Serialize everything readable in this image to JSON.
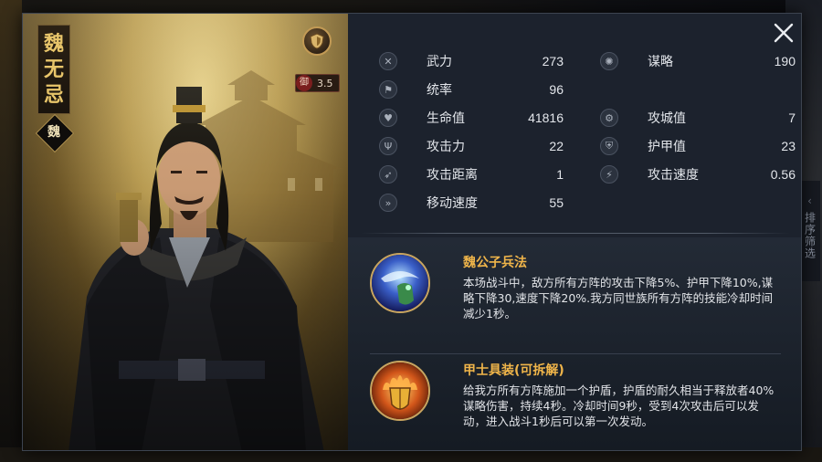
{
  "general": {
    "name_chars": [
      "魏",
      "无",
      "忌"
    ],
    "faction": "魏",
    "defense_label": "御",
    "defense_value": "3.5"
  },
  "stats_left": [
    {
      "icon": "crossed-swords-icon",
      "glyph": "✕",
      "label": "武力",
      "value": "273"
    },
    {
      "icon": "banner-icon",
      "glyph": "⚑",
      "label": "统率",
      "value": "96"
    },
    {
      "icon": "heart-icon",
      "glyph": "♥",
      "label": "生命值",
      "value": "41816"
    },
    {
      "icon": "trident-icon",
      "glyph": "Ψ",
      "label": "攻击力",
      "value": "22"
    },
    {
      "icon": "bow-icon",
      "glyph": "➶",
      "label": "攻击距离",
      "value": "1"
    },
    {
      "icon": "boot-icon",
      "glyph": "»",
      "label": "移动速度",
      "value": "55"
    }
  ],
  "stats_right": [
    {
      "icon": "brain-icon",
      "glyph": "✺",
      "label": "谋略",
      "value": "190"
    },
    {
      "icon": "catapult-icon",
      "glyph": "⚙",
      "label": "攻城值",
      "value": "7"
    },
    {
      "icon": "shield-icon",
      "glyph": "⛨",
      "label": "护甲值",
      "value": "23"
    },
    {
      "icon": "attack-speed-icon",
      "glyph": "⚡",
      "label": "攻击速度",
      "value": "0.56"
    }
  ],
  "skills": [
    {
      "icon": "water-dragon-skill-icon",
      "name": "魏公子兵法",
      "description": "本场战斗中，敌方所有方阵的攻击下降5%、护甲下降10%,谋略下降30,速度下降20%.我方同世族所有方阵的技能冷却时间减少1秒。"
    },
    {
      "icon": "fire-shield-skill-icon",
      "name": "甲士具装(可拆解)",
      "description": "给我方所有方阵施加一个护盾，护盾的耐久相当于释放者40%谋略伤害，持续4秒。冷却时间9秒，受到4次攻击后可以发动，进入战斗1秒后可以第一次发动。"
    }
  ],
  "side_tab": {
    "label": "排序筛选"
  },
  "colors": {
    "accent_gold": "#f0b54a",
    "name_gold": "#e8c56a",
    "panel": "#1c222d"
  }
}
